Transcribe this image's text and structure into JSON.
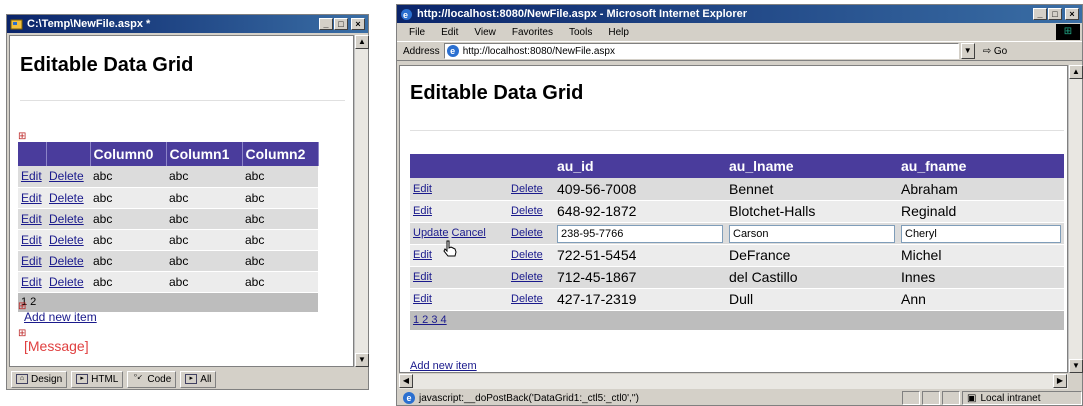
{
  "designer": {
    "title": "C:\\Temp\\NewFile.aspx *",
    "heading": "Editable Data Grid",
    "columns": [
      "Column0",
      "Column1",
      "Column2"
    ],
    "edit_label": "Edit",
    "delete_label": "Delete",
    "cell_value": "abc",
    "row_count": 6,
    "pager": "1 2",
    "add_new_item": "Add new item",
    "message": "[Message]",
    "tabs": [
      {
        "label": "Design",
        "icon": "design-icon"
      },
      {
        "label": "HTML",
        "icon": "html-icon"
      },
      {
        "label": "Code",
        "icon": "code-icon"
      },
      {
        "label": "All",
        "icon": "all-icon"
      }
    ]
  },
  "browser": {
    "title": "http://localhost:8080/NewFile.aspx - Microsoft Internet Explorer",
    "menu": [
      "File",
      "Edit",
      "View",
      "Favorites",
      "Tools",
      "Help"
    ],
    "address_label": "Address",
    "address_value": "http://localhost:8080/NewFile.aspx",
    "go_label": "Go",
    "heading": "Editable Data Grid",
    "columns": [
      "au_id",
      "au_lname",
      "au_fname"
    ],
    "rows": [
      {
        "action": "Edit",
        "delete": "Delete",
        "au_id": "409-56-7008",
        "au_lname": "Bennet",
        "au_fname": "Abraham"
      },
      {
        "action": "Edit",
        "delete": "Delete",
        "au_id": "648-92-1872",
        "au_lname": "Blotchet-Halls",
        "au_fname": "Reginald"
      },
      {
        "action": "Update",
        "cancel": "Cancel",
        "delete": "Delete",
        "au_id": "238-95-7766",
        "au_lname": "Carson",
        "au_fname": "Cheryl",
        "editing": true
      },
      {
        "action": "Edit",
        "delete": "Delete",
        "au_id": "722-51-5454",
        "au_lname": "DeFrance",
        "au_fname": "Michel"
      },
      {
        "action": "Edit",
        "delete": "Delete",
        "au_id": "712-45-1867",
        "au_lname": "del Castillo",
        "au_fname": "Innes"
      },
      {
        "action": "Edit",
        "delete": "Delete",
        "au_id": "427-17-2319",
        "au_lname": "Dull",
        "au_fname": "Ann"
      }
    ],
    "pager": "1 2 3 4",
    "add_new_item": "Add new item",
    "status_text": "javascript:__doPostBack('DataGrid1:_ctl5:_ctl0','')",
    "zone": "Local intranet"
  }
}
